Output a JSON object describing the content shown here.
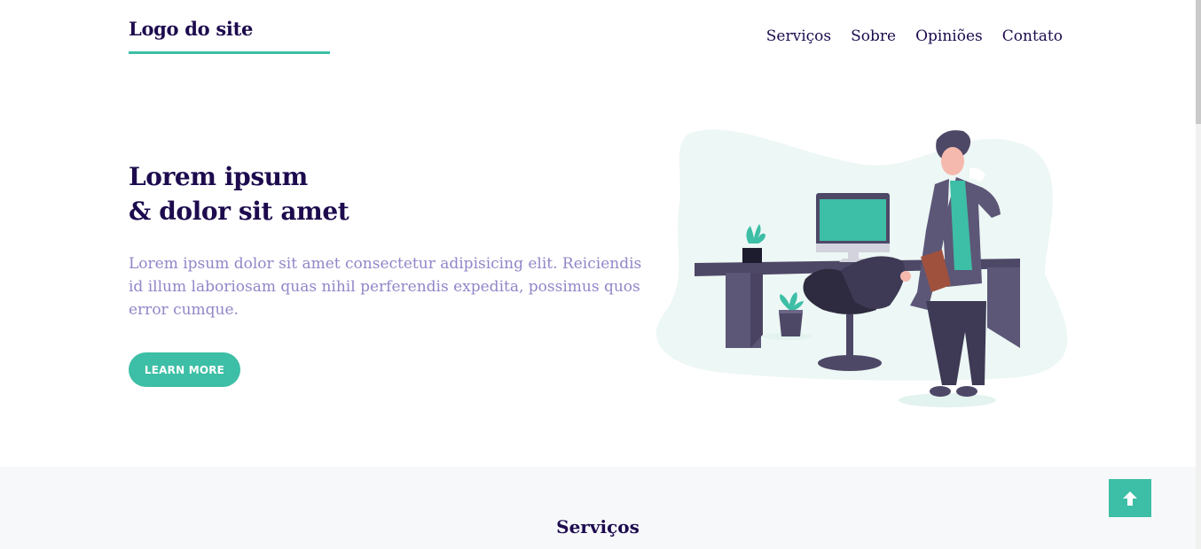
{
  "header": {
    "logo": "Logo do site",
    "nav": [
      "Serviços",
      "Sobre",
      "Opiniões",
      "Contato"
    ]
  },
  "hero": {
    "title_line1": "Lorem ipsum",
    "title_line2": "& dolor sit amet",
    "description": "Lorem ipsum dolor sit amet consectetur adipisicing elit. Reiciendis id illum laboriosam quas nihil perferendis expedita, possimus quos error cumque.",
    "button": "LEARN MORE"
  },
  "services": {
    "title": "Serviços"
  },
  "icons": {
    "back_to_top": "arrow-up-icon"
  },
  "colors": {
    "primary": "#1d0b4e",
    "accent": "#3dbea6",
    "muted_text": "#8f87c8",
    "section_bg": "#f7f8fa"
  }
}
